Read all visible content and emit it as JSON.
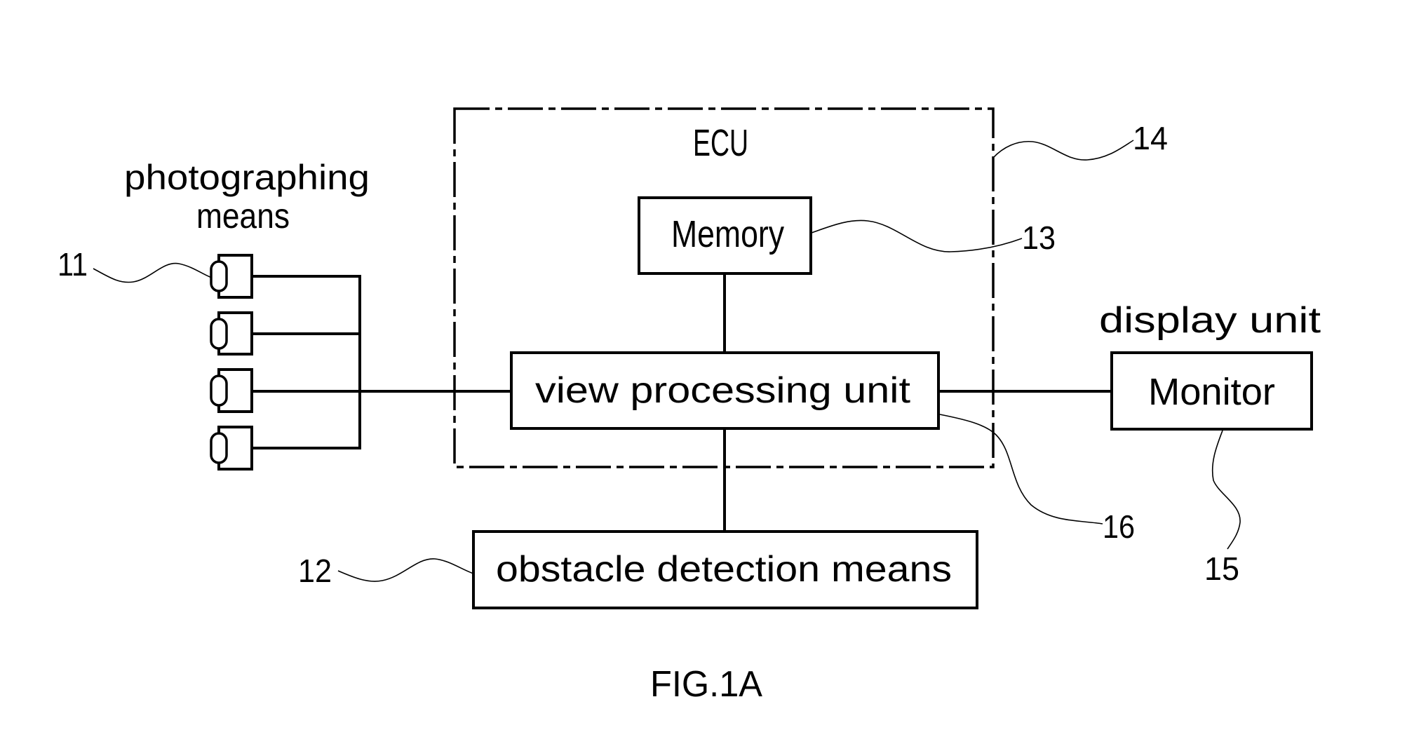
{
  "figure": {
    "caption": "FIG.1A",
    "colors": {
      "line": "#000000",
      "background": "#ffffff"
    }
  },
  "blocks": {
    "ecu": {
      "label": "ECU",
      "ref": "14"
    },
    "memory": {
      "label": "Memory",
      "ref": "13"
    },
    "view_processing_unit": {
      "label": "view processing unit",
      "ref": "16"
    },
    "obstacle_detection": {
      "label": "obstacle detection means",
      "ref": "12"
    },
    "monitor": {
      "label": "Monitor",
      "ref": "15",
      "group_label": "display unit"
    },
    "photographing_means": {
      "label_line1": "photographing",
      "label_line2": "means",
      "ref": "11",
      "camera_count": 4
    }
  },
  "connections": [
    {
      "from": "photographing_means",
      "to": "view_processing_unit"
    },
    {
      "from": "memory",
      "to": "view_processing_unit"
    },
    {
      "from": "view_processing_unit",
      "to": "monitor"
    },
    {
      "from": "view_processing_unit",
      "to": "obstacle_detection"
    }
  ]
}
